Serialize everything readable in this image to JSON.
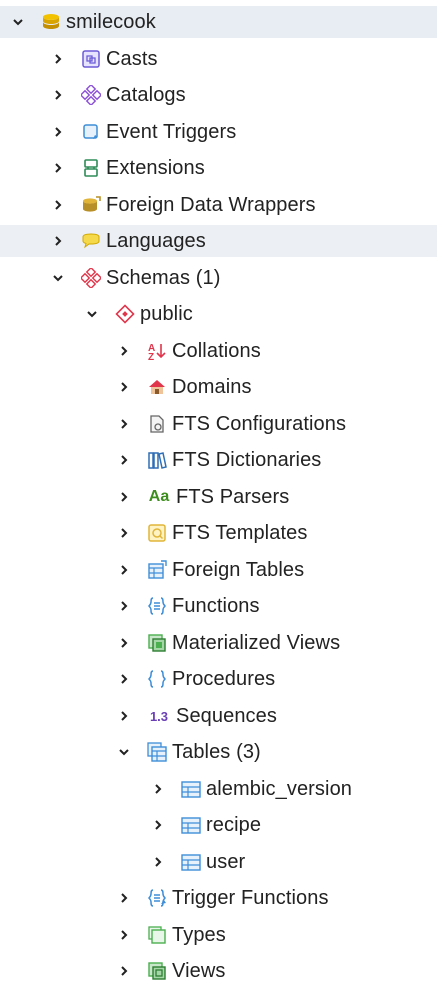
{
  "tree": {
    "database": {
      "label": "smilecook",
      "icon": "database-icon"
    },
    "casts": {
      "label": "Casts",
      "icon": "casts-icon"
    },
    "catalogs": {
      "label": "Catalogs",
      "icon": "catalogs-icon"
    },
    "event_triggers": {
      "label": "Event Triggers",
      "icon": "event-triggers-icon"
    },
    "extensions": {
      "label": "Extensions",
      "icon": "extensions-icon"
    },
    "foreign_data_wrappers": {
      "label": "Foreign Data Wrappers",
      "icon": "foreign-data-wrappers-icon"
    },
    "languages": {
      "label": "Languages",
      "icon": "languages-icon"
    },
    "schemas": {
      "label": "Schemas (1)",
      "icon": "schemas-icon"
    },
    "public": {
      "label": "public",
      "icon": "schema-icon"
    },
    "collations": {
      "label": "Collations",
      "icon": "collations-icon"
    },
    "domains": {
      "label": "Domains",
      "icon": "domains-icon"
    },
    "fts_configurations": {
      "label": "FTS Configurations",
      "icon": "fts-configurations-icon"
    },
    "fts_dictionaries": {
      "label": "FTS Dictionaries",
      "icon": "fts-dictionaries-icon"
    },
    "fts_parsers": {
      "label": "FTS Parsers",
      "icon": "fts-parsers-icon",
      "icon_text": "Aa"
    },
    "fts_templates": {
      "label": "FTS Templates",
      "icon": "fts-templates-icon"
    },
    "foreign_tables": {
      "label": "Foreign Tables",
      "icon": "foreign-tables-icon"
    },
    "functions": {
      "label": "Functions",
      "icon": "functions-icon"
    },
    "materialized_views": {
      "label": "Materialized Views",
      "icon": "materialized-views-icon"
    },
    "procedures": {
      "label": "Procedures",
      "icon": "procedures-icon"
    },
    "sequences": {
      "label": "Sequences",
      "icon": "sequences-icon",
      "icon_text": "1.3"
    },
    "tables": {
      "label": "Tables (3)",
      "icon": "tables-icon"
    },
    "alembic_version": {
      "label": "alembic_version",
      "icon": "table-icon"
    },
    "recipe": {
      "label": "recipe",
      "icon": "table-icon"
    },
    "user": {
      "label": "user",
      "icon": "table-icon"
    },
    "trigger_functions": {
      "label": "Trigger Functions",
      "icon": "trigger-functions-icon"
    },
    "types": {
      "label": "Types",
      "icon": "types-icon"
    },
    "views": {
      "label": "Views",
      "icon": "views-icon"
    }
  },
  "colors": {
    "highlight": "#eceff3",
    "chevron": "#222222",
    "database": "#d9a400",
    "table_blue": "#3f8ed8",
    "schema_red": "#e0354b",
    "view_green": "#4caf50"
  }
}
